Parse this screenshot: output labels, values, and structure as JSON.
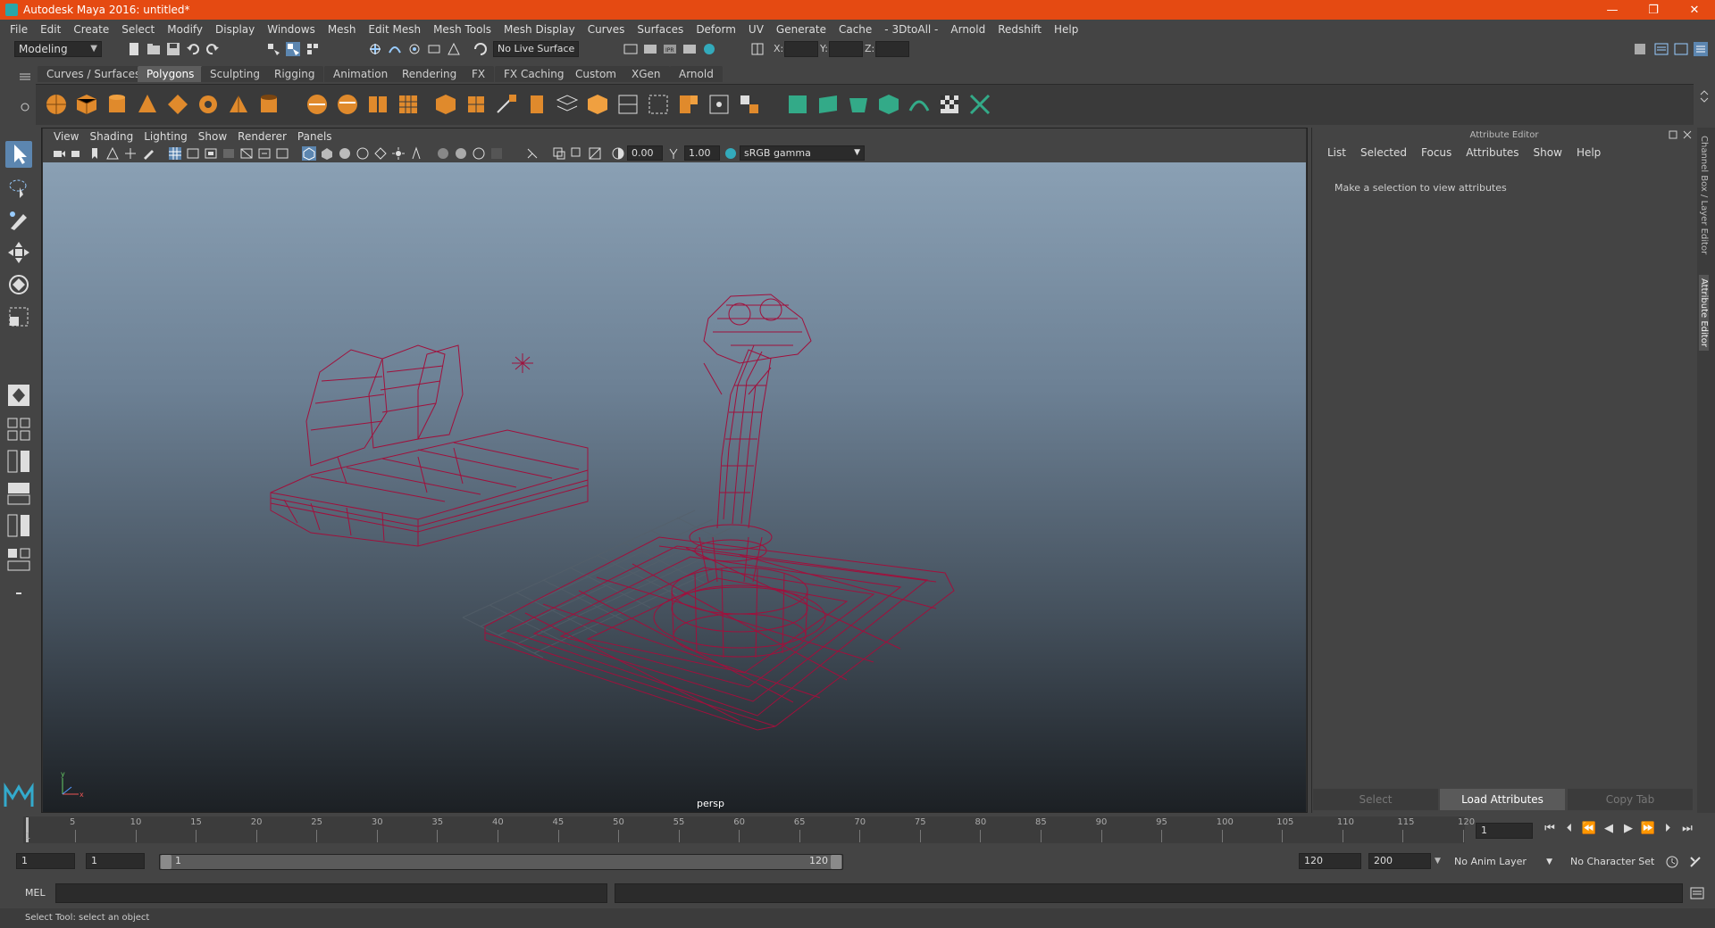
{
  "window": {
    "title": "Autodesk Maya 2016: untitled*",
    "minimize": "—",
    "restore": "❐",
    "close": "✕"
  },
  "menubar": [
    "File",
    "Edit",
    "Create",
    "Select",
    "Modify",
    "Display",
    "Windows",
    "Mesh",
    "Edit Mesh",
    "Mesh Tools",
    "Mesh Display",
    "Curves",
    "Surfaces",
    "Deform",
    "UV",
    "Generate",
    "Cache",
    "- 3DtoAll -",
    "Arnold",
    "Redshift",
    "Help"
  ],
  "status": {
    "mode": "Modeling",
    "live_surface": "No Live Surface",
    "x_label": "X:",
    "y_label": "Y:",
    "z_label": "Z:"
  },
  "shelf": {
    "tabs": [
      "Curves / Surfaces",
      "Polygons",
      "Sculpting",
      "Rigging",
      "Animation",
      "Rendering",
      "FX",
      "FX Caching",
      "Custom",
      "XGen",
      "Arnold"
    ],
    "active_tab": "Polygons"
  },
  "viewport": {
    "menu": [
      "View",
      "Shading",
      "Lighting",
      "Show",
      "Renderer",
      "Panels"
    ],
    "exposure": "0.00",
    "gamma": "1.00",
    "color_space": "sRGB gamma",
    "camera_label": "persp",
    "wire_color": "#a0103c"
  },
  "attribute_editor": {
    "title": "Attribute Editor",
    "menu": [
      "List",
      "Selected",
      "Focus",
      "Attributes",
      "Show",
      "Help"
    ],
    "hint": "Make a selection to view attributes",
    "buttons": {
      "select": "Select",
      "load": "Load Attributes",
      "copy": "Copy Tab"
    },
    "side_tabs": {
      "channel_box": "Channel Box / Layer Editor",
      "attribute_editor": "Attribute Editor"
    }
  },
  "timeline": {
    "ticks": [
      "5",
      "10",
      "15",
      "20",
      "25",
      "30",
      "35",
      "40",
      "45",
      "50",
      "55",
      "60",
      "65",
      "70",
      "75",
      "80",
      "85",
      "90",
      "95",
      "100",
      "105",
      "110",
      "115",
      "120"
    ],
    "first_tick": "1",
    "current_frame": "1",
    "range_start": "1",
    "range_inner_start": "1",
    "range_slider_start": "1",
    "range_slider_end": "120",
    "range_end": "120",
    "anim_end": "200",
    "anim_layer": "No Anim Layer",
    "character_set": "No Character Set"
  },
  "command": {
    "label": "MEL",
    "help": "Select Tool: select an object"
  }
}
